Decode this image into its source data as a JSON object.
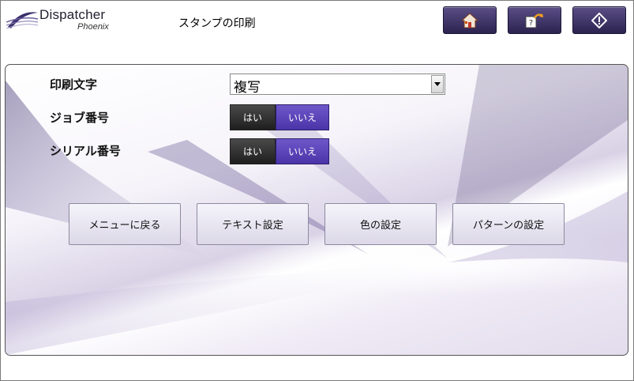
{
  "logo": {
    "brand": "Dispatcher",
    "sub": "Phoenix"
  },
  "header": {
    "title": "スタンプの印刷"
  },
  "header_buttons": [
    {
      "name": "home",
      "icon": "home-icon"
    },
    {
      "name": "help",
      "icon": "help-return-icon"
    },
    {
      "name": "start",
      "icon": "start-diamond-icon"
    }
  ],
  "form": {
    "print_text": {
      "label": "印刷文字",
      "value": "複写"
    },
    "job_number": {
      "label": "ジョブ番号",
      "yes": "はい",
      "no": "いいえ",
      "selected": "no"
    },
    "serial_number": {
      "label": "シリアル番号",
      "yes": "はい",
      "no": "いいえ",
      "selected": "no"
    }
  },
  "actions": [
    {
      "label": "メニューに戻る"
    },
    {
      "label": "テキスト設定"
    },
    {
      "label": "色の設定"
    },
    {
      "label": "パターンの設定"
    }
  ],
  "colors": {
    "accent": "#4a34a8",
    "header_button": "#2c2350"
  }
}
